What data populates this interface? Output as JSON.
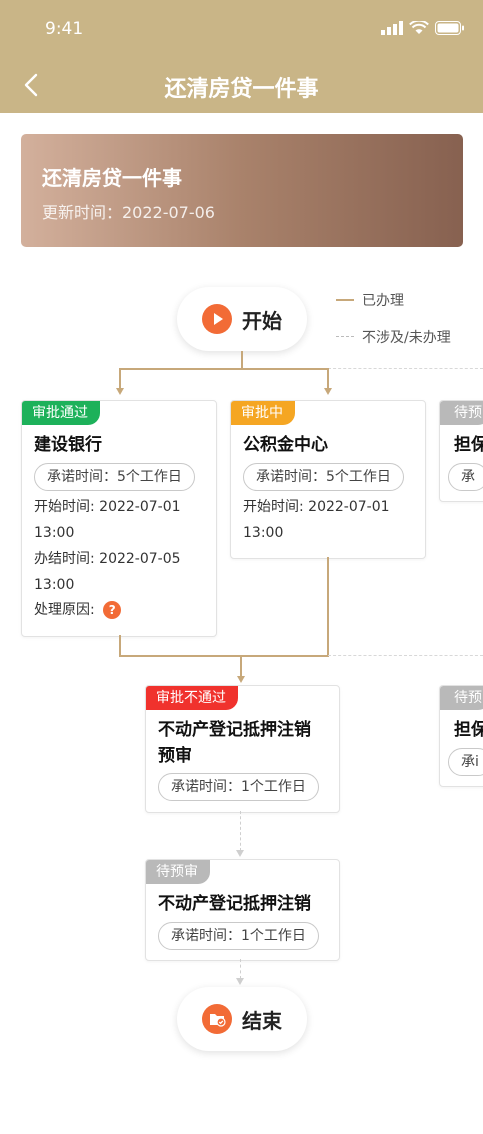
{
  "status_bar": {
    "time": "9:41"
  },
  "nav": {
    "title": "还清房贷一件事"
  },
  "banner": {
    "title": "还清房贷一件事",
    "updated": "更新时间：2022-07-06"
  },
  "start": {
    "label": "开始"
  },
  "legend": {
    "done": "已办理",
    "not_applicable": "不涉及/未办理"
  },
  "cards": {
    "bank": {
      "badge": "审批通过",
      "title": "建设银行",
      "promise": "承诺时间：5个工作日",
      "start_time_1": "开始时间: 2022-07-01",
      "start_time_2": "13:00",
      "end_time_1": "办结时间: 2022-07-05",
      "end_time_2": "13:00",
      "reason": "处理原因:"
    },
    "fund": {
      "badge": "审批中",
      "title": "公积金中心",
      "promise": "承诺时间：5个工作日",
      "start_time_1": "开始时间: 2022-07-01",
      "start_time_2": "13:00"
    },
    "guarantee_top": {
      "badge": "待预",
      "title": "担保",
      "promise": "承"
    },
    "pre_review": {
      "badge": "审批不通过",
      "title_1": "不动产登记抵押注销",
      "title_2": "预审",
      "promise": "承诺时间：1个工作日"
    },
    "guarantee_mid": {
      "badge": "待预",
      "title": "担保",
      "promise": "承i"
    },
    "cancel": {
      "badge": "待预审",
      "title": "不动产登记抵押注销",
      "promise": "承诺时间：1个工作日"
    }
  },
  "end": {
    "label": "结束"
  },
  "colors": {
    "header": "#c9b587",
    "approved": "#1db15a",
    "pending": "#f5a623",
    "rejected": "#f0322d",
    "waiting": "#b9b9b9",
    "accent": "#f26b36"
  },
  "icons": {
    "back": "chevron-left-icon",
    "start": "play-icon",
    "end": "folder-check-icon",
    "help": "question-icon"
  }
}
